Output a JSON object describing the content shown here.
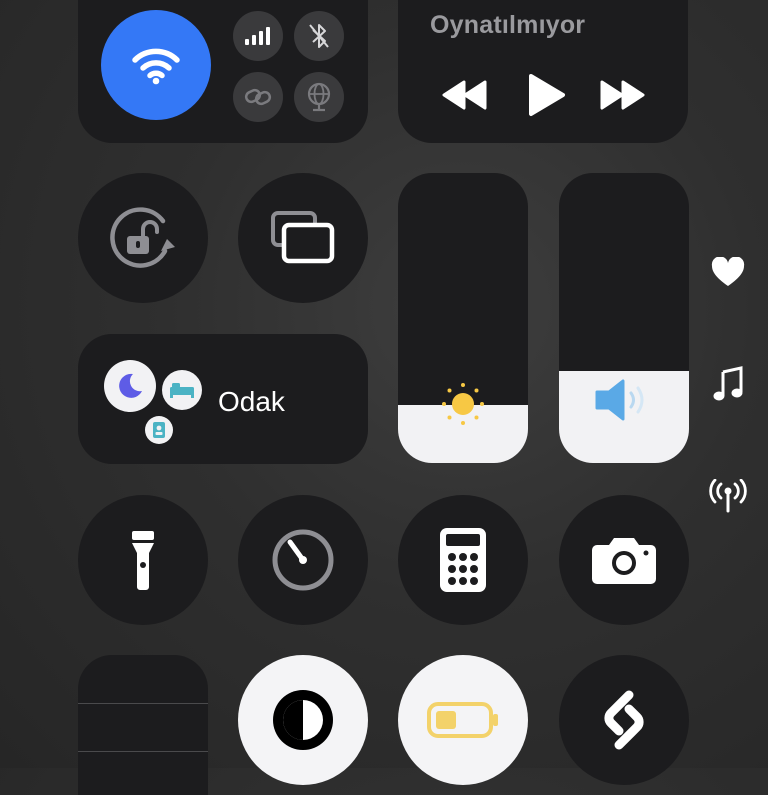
{
  "connectivity": {
    "wifi": {
      "icon": "wifi-icon",
      "active": true,
      "color": "#3478f6"
    },
    "cellular": {
      "icon": "cellular-signal-icon"
    },
    "bluetooth": {
      "icon": "bluetooth-off-icon",
      "active": false
    },
    "airdrop": {
      "icon": "airdrop-icon"
    },
    "hotspot": {
      "icon": "personal-hotspot-icon"
    }
  },
  "media": {
    "title": "Oynatılmıyor",
    "controls": [
      "rewind-icon",
      "play-icon",
      "fast-forward-icon"
    ]
  },
  "toggles": {
    "rotation_lock": {
      "icon": "rotation-lock-icon"
    },
    "screen_mirroring": {
      "icon": "screen-mirroring-icon"
    }
  },
  "focus": {
    "label": "Odak",
    "icons": [
      "moon-icon",
      "bed-icon",
      "id-badge-icon"
    ]
  },
  "sliders": {
    "brightness": {
      "icon": "sun-icon",
      "level": 0.21,
      "icon_color": "#f7c844"
    },
    "volume": {
      "icon": "speaker-icon",
      "level": 0.31,
      "icon_color": "#5aa9e6"
    }
  },
  "side": [
    "heart-icon",
    "music-note-icon",
    "antenna-icon"
  ],
  "shortcuts_row1": [
    "flashlight-icon",
    "timer-icon",
    "calculator-icon",
    "camera-icon"
  ],
  "shortcuts_row2": [
    "notes-icon",
    "dark-mode-icon",
    "low-power-mode-icon",
    "shazam-icon"
  ],
  "colors": {
    "accent": "#3478f6",
    "tile": "#1c1c1e",
    "battery": "#f3d26a"
  }
}
